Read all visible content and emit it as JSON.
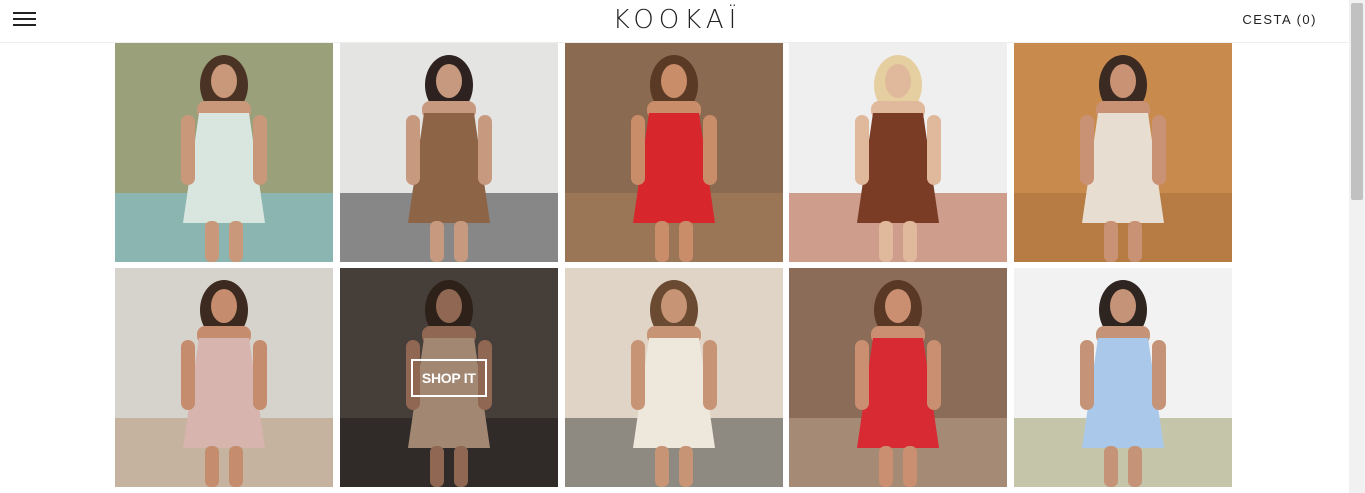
{
  "header": {
    "logo": "KOOKAÏ",
    "cart_label": "CESTA (0)"
  },
  "gallery": {
    "shop_label": "SHOP IT",
    "tiles": [
      {
        "name": "floral-mini-dress",
        "bg": "#9aa07a",
        "figure": "#d8e6df",
        "accent": "#7fc6dd",
        "skin": "#c9977a",
        "hair": "#4a3325"
      },
      {
        "name": "brown-shorts-set",
        "bg": "#e4e4e2",
        "figure": "#8e6446",
        "accent": "#3a3a3c",
        "skin": "#c79a80",
        "hair": "#2e2220"
      },
      {
        "name": "red-floral-dress",
        "bg": "#8a6a50",
        "figure": "#d8262d",
        "accent": "#a8805c",
        "skin": "#c98d6a",
        "hair": "#5a3a24"
      },
      {
        "name": "brown-trousers-outfit",
        "bg": "#efefef",
        "figure": "#7a3c25",
        "accent": "#b25a3a",
        "skin": "#e0b89c",
        "hair": "#e5cfa0"
      },
      {
        "name": "cream-blazer",
        "bg": "#c98a4e",
        "figure": "#e7ddd0",
        "accent": "#a8703c",
        "skin": "#c99274",
        "hair": "#3a2a22"
      },
      {
        "name": "pink-midi-skirt",
        "bg": "#d6d2cc",
        "figure": "#d7b4ae",
        "accent": "#b8997a",
        "skin": "#c58d6e",
        "hair": "#3c2a20"
      },
      {
        "name": "beige-pinafore-dress",
        "bg": "#5d534d",
        "figure": "#d8b49a",
        "accent": "#2a2624",
        "skin": "#c08a6e",
        "hair": "#3d2d22"
      },
      {
        "name": "white-shorts-set",
        "bg": "#e0d4c6",
        "figure": "#ede7dc",
        "accent": "#4a4a48",
        "skin": "#c79576",
        "hair": "#6a4a30"
      },
      {
        "name": "red-floral-dress-seated",
        "bg": "#8a6c58",
        "figure": "#d72a33",
        "accent": "#bba48e",
        "skin": "#c98f70",
        "hair": "#5a3826"
      },
      {
        "name": "blue-shirt-dress",
        "bg": "#f2f2f2",
        "figure": "#a9c8ea",
        "accent": "#a0a070",
        "skin": "#c59478",
        "hair": "#2e2420"
      }
    ]
  }
}
